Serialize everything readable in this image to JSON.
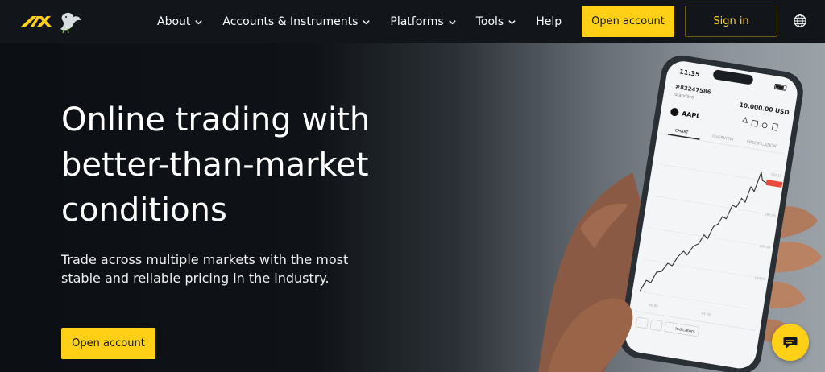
{
  "nav": {
    "items": [
      {
        "label": "About",
        "dropdown": true
      },
      {
        "label": "Accounts & Instruments",
        "dropdown": true
      },
      {
        "label": "Platforms",
        "dropdown": true
      },
      {
        "label": "Tools",
        "dropdown": true
      },
      {
        "label": "Help",
        "dropdown": false
      }
    ],
    "open_account": "Open account",
    "sign_in": "Sign in"
  },
  "hero": {
    "headline": "Online trading with better-than-market conditions",
    "subtitle": "Trade across multiple markets with the most stable and reliable pricing in the industry.",
    "cta": "Open account"
  },
  "phone": {
    "time": "11:35",
    "account_id": "#82247586",
    "account_type": "Standard",
    "balance": "10,000.00 USD",
    "symbol": "AAPL",
    "tabs": [
      "CHART",
      "OVERVIEW",
      "SPECIFICATION"
    ],
    "footer_indicators": "Indicators"
  },
  "colors": {
    "accent": "#ffd016",
    "header_bg": "#12161b",
    "hero_bg": "#0c0f13"
  }
}
